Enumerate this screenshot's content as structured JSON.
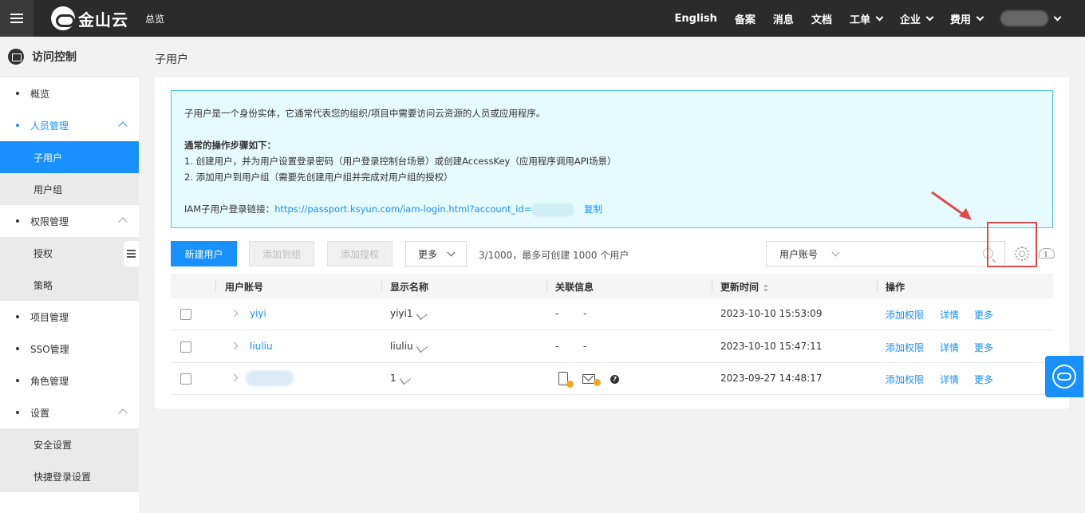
{
  "topbar": {
    "logo_text": "金山云",
    "overview": "总览",
    "right_items": [
      {
        "label": "English",
        "dropdown": false
      },
      {
        "label": "备案",
        "dropdown": false
      },
      {
        "label": "消息",
        "dropdown": false
      },
      {
        "label": "文档",
        "dropdown": false
      },
      {
        "label": "工单",
        "dropdown": true
      },
      {
        "label": "企业",
        "dropdown": true
      },
      {
        "label": "费用",
        "dropdown": true
      }
    ]
  },
  "sidebar": {
    "title": "访问控制",
    "items": [
      {
        "label": "概览",
        "type": "item"
      },
      {
        "label": "人员管理",
        "type": "group",
        "expanded": true
      },
      {
        "label": "子用户",
        "type": "sub",
        "active": true
      },
      {
        "label": "用户组",
        "type": "sub"
      },
      {
        "label": "权限管理",
        "type": "group",
        "expanded": true
      },
      {
        "label": "授权",
        "type": "sub"
      },
      {
        "label": "策略",
        "type": "sub"
      },
      {
        "label": "项目管理",
        "type": "item"
      },
      {
        "label": "SSO管理",
        "type": "item"
      },
      {
        "label": "角色管理",
        "type": "item"
      },
      {
        "label": "设置",
        "type": "group",
        "expanded": true
      },
      {
        "label": "安全设置",
        "type": "sub"
      },
      {
        "label": "快捷登录设置",
        "type": "sub"
      }
    ]
  },
  "page": {
    "title": "子用户"
  },
  "info": {
    "intro": "子用户是一个身份实体，它通常代表您的组织/项目中需要访问云资源的人员或应用程序。",
    "steps_title": "通常的操作步骤如下：",
    "step1": "1. 创建用户，并为用户设置登录密码（用户登录控制台场景）或创建AccessKey（应用程序调用API场景）",
    "step2": "2. 添加用户到用户组（需要先创建用户组并完成对用户组的授权）",
    "login_label": "IAM子用户登录链接：",
    "login_url": "https://passport.ksyun.com/iam-login.html?account_id=",
    "copy_label": "复制"
  },
  "toolbar": {
    "new_user": "新建用户",
    "add_to_group": "添加到组",
    "add_auth": "添加授权",
    "more": "更多",
    "count_text": "3/1000，最多可创建 1000 个用户",
    "filter_select": "用户账号",
    "search_placeholder": ""
  },
  "table": {
    "headers": {
      "account": "用户账号",
      "display_name": "显示名称",
      "related": "关联信息",
      "updated": "更新时间",
      "actions": "操作"
    },
    "rows": [
      {
        "account": "yiyi",
        "display_name": "yiyi1",
        "related_a": "-",
        "related_b": "-",
        "updated": "2023-10-10 15:53:09"
      },
      {
        "account": "liuliu",
        "display_name": "liuliu",
        "related_a": "-",
        "related_b": "-",
        "updated": "2023-10-10 15:47:11"
      },
      {
        "account": "",
        "display_name": "1",
        "related_a": "",
        "related_b": "",
        "updated": "2023-09-27 14:48:17"
      }
    ],
    "action_labels": {
      "add_perm": "添加权限",
      "detail": "详情",
      "more": "更多"
    }
  },
  "colors": {
    "accent": "#1890ff",
    "topbar": "#2b2b2b",
    "info_bg": "#e6fbfe",
    "highlight": "#e04a4a"
  }
}
